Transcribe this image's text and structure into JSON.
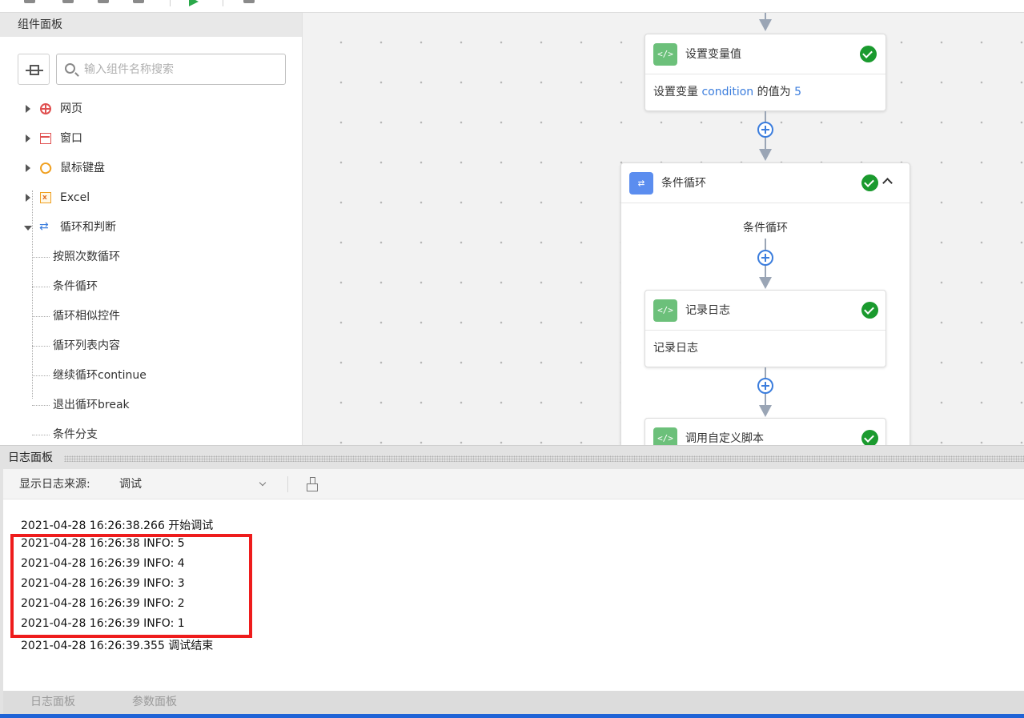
{
  "left_panel": {
    "title": "组件面板",
    "search": {
      "placeholder": "输入组件名称搜索",
      "value": ""
    },
    "tree": [
      {
        "label": "网页",
        "icon": "globe-icon",
        "expanded": false
      },
      {
        "label": "窗口",
        "icon": "window-icon",
        "expanded": false
      },
      {
        "label": "鼠标键盘",
        "icon": "mouse-icon",
        "expanded": false
      },
      {
        "label": "Excel",
        "icon": "excel-icon",
        "expanded": false
      },
      {
        "label": "循环和判断",
        "icon": "loop-icon",
        "expanded": true,
        "children": [
          "按照次数循环",
          "条件循环",
          "循环相似控件",
          "循环列表内容",
          "继续循环continue",
          "退出循环break",
          "条件分支"
        ]
      }
    ]
  },
  "canvas": {
    "nodes": {
      "set_var": {
        "title": "设置变量值",
        "body_prefix": "设置变量 ",
        "var_name": "condition",
        "body_mid": " 的值为 ",
        "value": "5"
      },
      "loop": {
        "title": "条件循环",
        "inner_label": "条件循环"
      },
      "log": {
        "title": "记录日志",
        "body": "记录日志"
      },
      "script": {
        "title": "调用自定义脚本"
      }
    }
  },
  "log_panel": {
    "title": "日志面板",
    "source_label": "显示日志来源:",
    "source_value": "调试",
    "lines": [
      "2021-04-28 16:26:38.266 开始调试",
      "2021-04-28 16:26:38 INFO: 5",
      "2021-04-28 16:26:39 INFO: 4",
      "2021-04-28 16:26:39 INFO: 3",
      "2021-04-28 16:26:39 INFO: 2",
      "2021-04-28 16:26:39 INFO: 1",
      "2021-04-28 16:26:39.355 调试结束"
    ]
  },
  "bottom_tabs": [
    "日志面板",
    "参数面板"
  ],
  "colors": {
    "accent": "#3b7ddd",
    "success": "#1a9a2e",
    "highlight_box": "#ee1c1c",
    "status_bar": "#1f63d6"
  }
}
